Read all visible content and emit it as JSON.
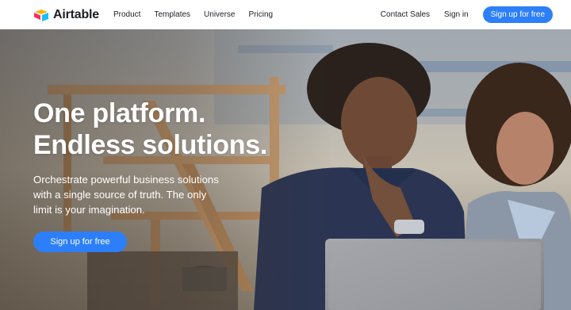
{
  "brand": {
    "name": "Airtable"
  },
  "nav": {
    "links": [
      "Product",
      "Templates",
      "Universe",
      "Pricing"
    ],
    "contact_sales": "Contact Sales",
    "sign_in": "Sign in",
    "signup": "Sign up for free"
  },
  "hero": {
    "headline_line1": "One platform.",
    "headline_line2": "Endless solutions.",
    "subtext": "Orchestrate powerful business solutions with a single source of truth. The only limit is your imagination.",
    "cta": "Sign up for free"
  },
  "colors": {
    "accent": "#2d7ff9",
    "logo_yellow": "#fcb400",
    "logo_blue": "#18bfff",
    "logo_red": "#f82b60",
    "text_dark": "#1d1f25"
  }
}
